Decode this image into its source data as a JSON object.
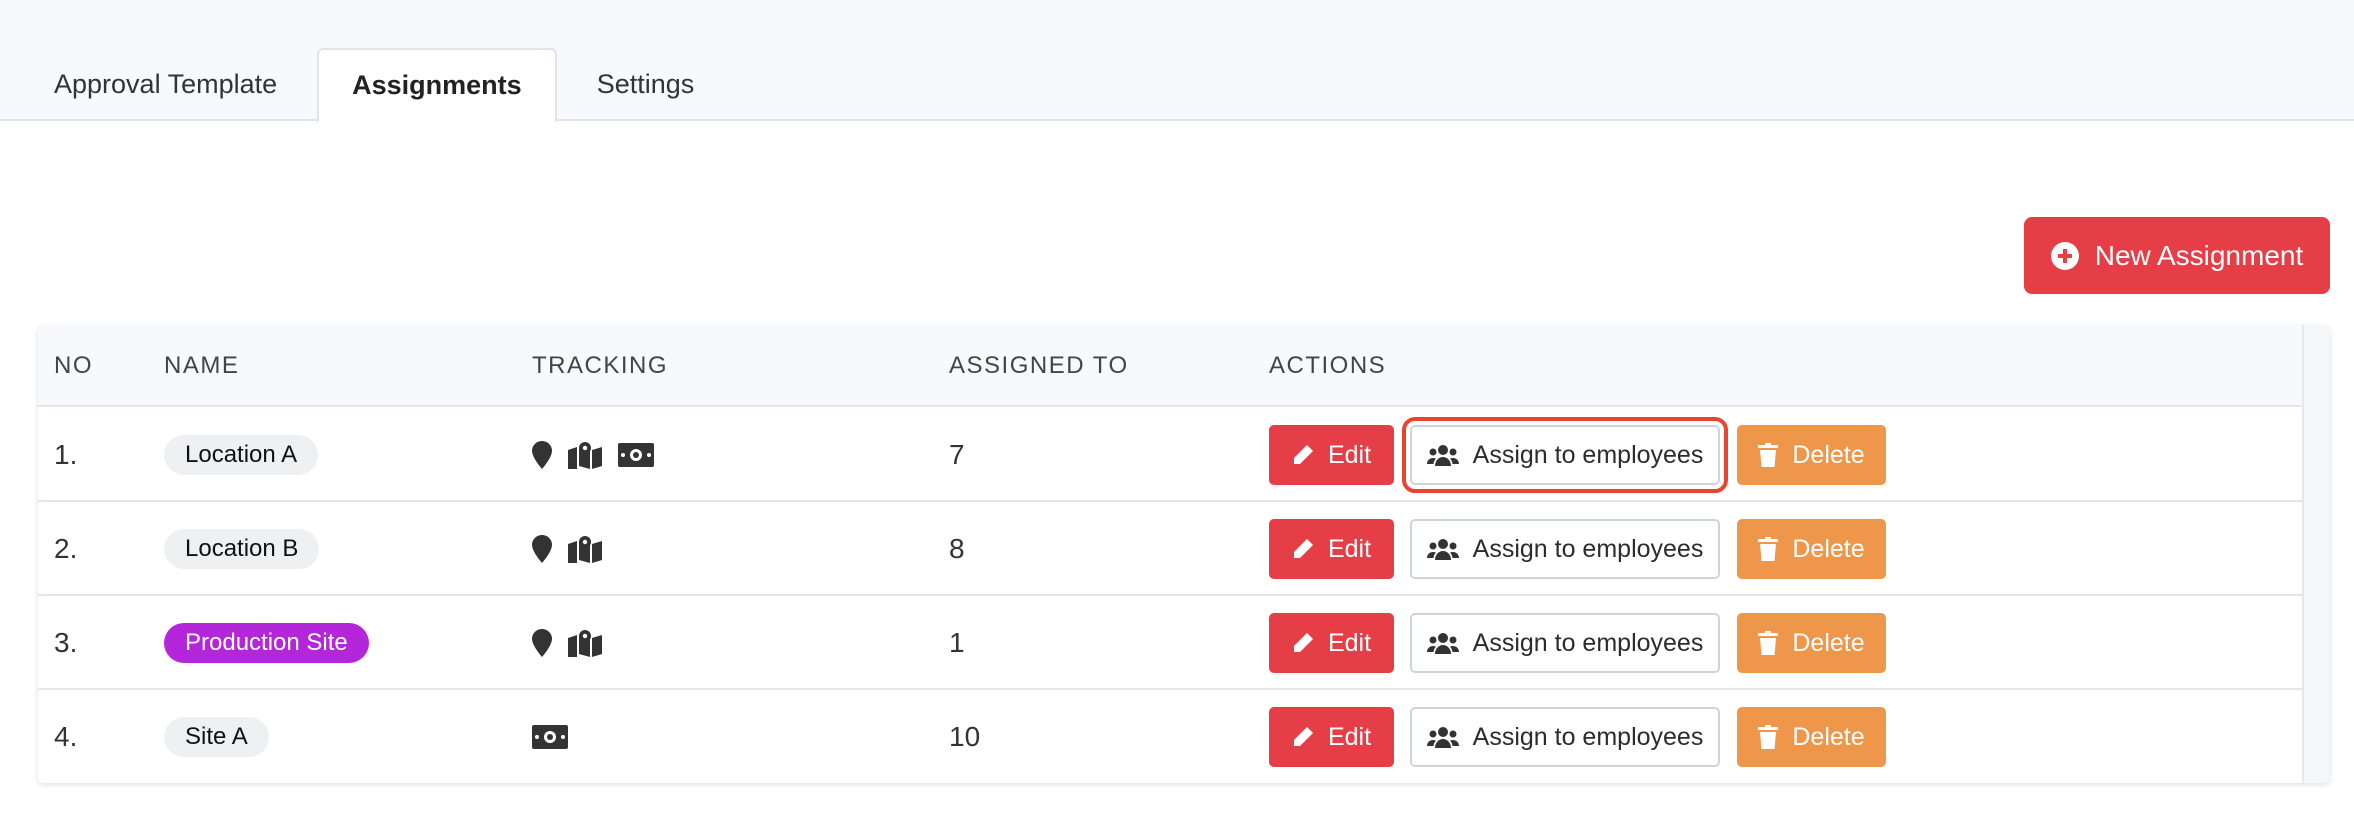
{
  "tabs": [
    {
      "label": "Approval Template",
      "active": false
    },
    {
      "label": "Assignments",
      "active": true
    },
    {
      "label": "Settings",
      "active": false
    }
  ],
  "toolbar": {
    "new_assignment_label": "New Assignment"
  },
  "table": {
    "headers": {
      "no": "NO",
      "name": "NAME",
      "tracking": "TRACKING",
      "assigned_to": "ASSIGNED TO",
      "actions": "ACTIONS"
    },
    "rows": [
      {
        "no": "1.",
        "name": "Location A",
        "tag_color": "#eff0f2",
        "tracking": [
          "location-pin-icon",
          "map-icon",
          "money-icon"
        ],
        "assigned_to": "7"
      },
      {
        "no": "2.",
        "name": "Location B",
        "tag_color": "#eff0f2",
        "tracking": [
          "location-pin-icon",
          "map-icon"
        ],
        "assigned_to": "8"
      },
      {
        "no": "3.",
        "name": "Production Site",
        "tag_color": "#b326d9",
        "tracking": [
          "location-pin-icon",
          "map-icon"
        ],
        "assigned_to": "1"
      },
      {
        "no": "4.",
        "name": "Site A",
        "tag_color": "#eff0f2",
        "tracking": [
          "money-icon"
        ],
        "assigned_to": "10"
      }
    ],
    "actions": {
      "edit_label": "Edit",
      "assign_label": "Assign to employees",
      "delete_label": "Delete"
    }
  },
  "colors": {
    "primary_red": "#e53e46",
    "delete_orange": "#ee9649",
    "highlight_outline": "#e8452f"
  }
}
